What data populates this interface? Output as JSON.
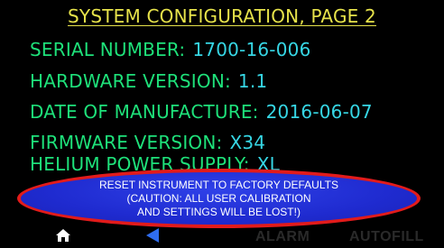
{
  "title": "SYSTEM CONFIGURATION, PAGE 2",
  "fields": {
    "serial": {
      "label": "SERIAL NUMBER:",
      "value": "1700-16-006"
    },
    "hardware": {
      "label": "HARDWARE VERSION:",
      "value": "1.1"
    },
    "manufacture_date": {
      "label": "DATE OF MANUFACTURE:",
      "value": "2016-06-07"
    },
    "firmware": {
      "label": "FIRMWARE VERSION:",
      "value": "X34"
    },
    "helium": {
      "label": "HELIUM POWER SUPPLY:",
      "value": "XL"
    }
  },
  "reset_button": {
    "line1": "RESET INSTRUMENT TO FACTORY DEFAULTS",
    "line2": "(CAUTION: ALL USER CALIBRATION",
    "line3": "AND SETTINGS WILL BE LOST!)"
  },
  "bottom_bar": {
    "home_icon": "home-icon",
    "back_icon": "back-arrow-icon",
    "alarm_label": "ALARM",
    "autofill_label": "AUTOFILL"
  },
  "colors": {
    "title": "#e6e24a",
    "label": "#1ee17a",
    "value": "#36d6e4",
    "button_fill": "#1f2bd0",
    "button_border": "#e21b1b",
    "inactive_tab": "#2a2a2a",
    "back_arrow": "#2f6df0"
  }
}
